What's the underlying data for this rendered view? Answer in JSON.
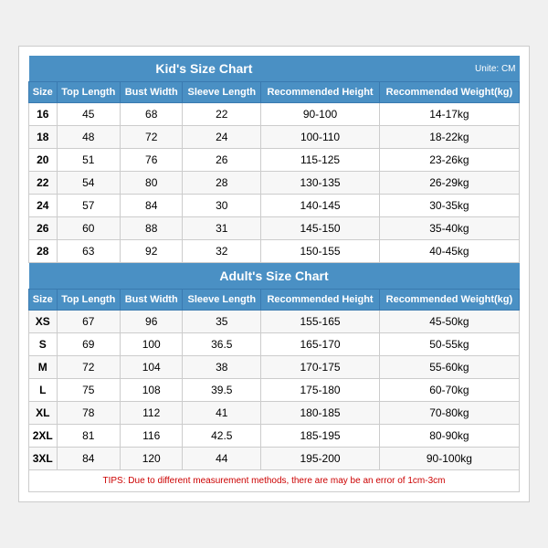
{
  "kids_chart": {
    "title": "Kid's Size Chart",
    "unit": "Unite: CM",
    "headers": [
      "Size",
      "Top Length",
      "Bust Width",
      "Sleeve Length",
      "Recommended Height",
      "Recommended Weight(kg)"
    ],
    "rows": [
      [
        "16",
        "45",
        "68",
        "22",
        "90-100",
        "14-17kg"
      ],
      [
        "18",
        "48",
        "72",
        "24",
        "100-110",
        "18-22kg"
      ],
      [
        "20",
        "51",
        "76",
        "26",
        "115-125",
        "23-26kg"
      ],
      [
        "22",
        "54",
        "80",
        "28",
        "130-135",
        "26-29kg"
      ],
      [
        "24",
        "57",
        "84",
        "30",
        "140-145",
        "30-35kg"
      ],
      [
        "26",
        "60",
        "88",
        "31",
        "145-150",
        "35-40kg"
      ],
      [
        "28",
        "63",
        "92",
        "32",
        "150-155",
        "40-45kg"
      ]
    ]
  },
  "adult_chart": {
    "title": "Adult's Size Chart",
    "headers": [
      "Size",
      "Top Length",
      "Bust Width",
      "Sleeve Length",
      "Recommended Height",
      "Recommended Weight(kg)"
    ],
    "rows": [
      [
        "XS",
        "67",
        "96",
        "35",
        "155-165",
        "45-50kg"
      ],
      [
        "S",
        "69",
        "100",
        "36.5",
        "165-170",
        "50-55kg"
      ],
      [
        "M",
        "72",
        "104",
        "38",
        "170-175",
        "55-60kg"
      ],
      [
        "L",
        "75",
        "108",
        "39.5",
        "175-180",
        "60-70kg"
      ],
      [
        "XL",
        "78",
        "112",
        "41",
        "180-185",
        "70-80kg"
      ],
      [
        "2XL",
        "81",
        "116",
        "42.5",
        "185-195",
        "80-90kg"
      ],
      [
        "3XL",
        "84",
        "120",
        "44",
        "195-200",
        "90-100kg"
      ]
    ]
  },
  "tips": "TIPS: Due to different measurement methods, there are may be an error of 1cm-3cm"
}
